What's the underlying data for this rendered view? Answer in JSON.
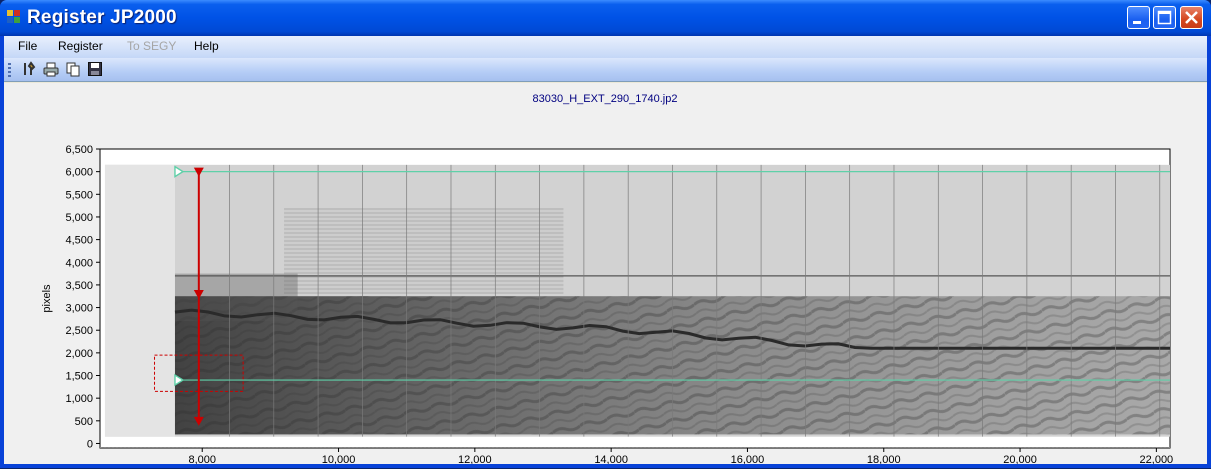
{
  "window": {
    "title": "Register JP2000"
  },
  "menu": {
    "items": [
      {
        "label": "File",
        "enabled": true
      },
      {
        "label": "Register",
        "enabled": true
      },
      {
        "label": "To SEGY",
        "enabled": false
      },
      {
        "label": "Help",
        "enabled": true
      }
    ]
  },
  "toolbar": {
    "icons": [
      "tools-icon",
      "print-icon",
      "copy-icon",
      "save-icon"
    ]
  },
  "plot": {
    "title": "83030_H_EXT_290_1740.jp2",
    "xlabel": "pixels",
    "ylabel": "pixels",
    "xticks": [
      "8,000",
      "10,000",
      "12,000",
      "14,000",
      "16,000",
      "18,000",
      "20,000",
      "22,000"
    ],
    "yticks": [
      "0",
      "500",
      "1,000",
      "1,500",
      "2,000",
      "2,500",
      "3,000",
      "3,500",
      "4,000",
      "4,500",
      "5,000",
      "5,500",
      "6,000",
      "6,500"
    ],
    "colors": {
      "marker": "#cc0000",
      "guide_line": "#5fd0a8",
      "selection_box": "#cc0000",
      "title_text": "#000080"
    }
  },
  "chart_data": {
    "type": "scatter",
    "title": "83030_H_EXT_290_1740.jp2",
    "xlabel": "pixels",
    "ylabel": "pixels",
    "xlim": [
      6500,
      22200
    ],
    "ylim": [
      -100,
      6500
    ],
    "grid": false,
    "guide_lines": [
      {
        "y": 6000,
        "x_start": 7600,
        "x_end": 22200
      },
      {
        "y": 1400,
        "x_start": 7600,
        "x_end": 22200
      }
    ],
    "marker_line": {
      "x": 7950,
      "y_values": [
        6000,
        3300,
        500
      ]
    },
    "selection_box": {
      "x": [
        7300,
        8600
      ],
      "y": [
        1150,
        1950
      ]
    }
  }
}
